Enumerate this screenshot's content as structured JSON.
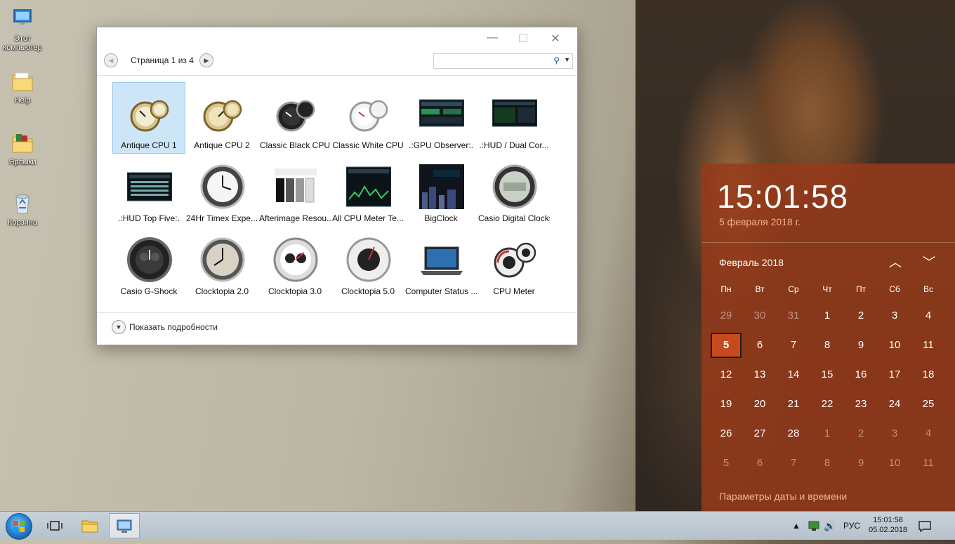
{
  "desktop": {
    "icons": [
      {
        "label": "Этот компьютер",
        "icon": "computer-icon"
      },
      {
        "label": "Help",
        "icon": "folder-icon"
      },
      {
        "label": "Ярлыки",
        "icon": "folder-icon"
      },
      {
        "label": "Корзина",
        "icon": "recycle-bin-icon"
      }
    ]
  },
  "gadget_window": {
    "page_label": "Страница 1 из 4",
    "search": {
      "value": "",
      "placeholder": ""
    },
    "gadgets": [
      {
        "name": "Antique CPU 1",
        "selected": true
      },
      {
        "name": "Antique CPU 2"
      },
      {
        "name": "Classic Black CPU"
      },
      {
        "name": "Classic White CPU"
      },
      {
        "name": ".:GPU Observer:."
      },
      {
        "name": ".:HUD / Dual Cor..."
      },
      {
        "name": ".:HUD Top Five:."
      },
      {
        "name": "24Hr Timex Expe..."
      },
      {
        "name": "Afterimage Resou..."
      },
      {
        "name": "All CPU Meter Te..."
      },
      {
        "name": "BigClock"
      },
      {
        "name": "Casio Digital Clocks"
      },
      {
        "name": "Casio G-Shock"
      },
      {
        "name": "Clocktopia 2.0"
      },
      {
        "name": "Clocktopia 3.0"
      },
      {
        "name": "Clocktopia 5.0"
      },
      {
        "name": "Computer Status ..."
      },
      {
        "name": "CPU Meter"
      }
    ],
    "details_label": "Показать подробности"
  },
  "calendar": {
    "time": "15:01:58",
    "date_long": "5 февраля 2018 г.",
    "month": "Февраль 2018",
    "weekdays": [
      "Пн",
      "Вт",
      "Ср",
      "Чт",
      "Пт",
      "Сб",
      "Вс"
    ],
    "weeks": [
      [
        "29",
        "30",
        "31",
        "1",
        "2",
        "3",
        "4"
      ],
      [
        "5",
        "6",
        "7",
        "8",
        "9",
        "10",
        "11"
      ],
      [
        "12",
        "13",
        "14",
        "15",
        "16",
        "17",
        "18"
      ],
      [
        "19",
        "20",
        "21",
        "22",
        "23",
        "24",
        "25"
      ],
      [
        "26",
        "27",
        "28",
        "1",
        "2",
        "3",
        "4"
      ],
      [
        "5",
        "6",
        "7",
        "8",
        "9",
        "10",
        "11"
      ]
    ],
    "dim_cells": [
      [
        0,
        0
      ],
      [
        0,
        1
      ],
      [
        0,
        2
      ],
      [
        4,
        3
      ],
      [
        4,
        4
      ],
      [
        4,
        5
      ],
      [
        4,
        6
      ],
      [
        5,
        0
      ],
      [
        5,
        1
      ],
      [
        5,
        2
      ],
      [
        5,
        3
      ],
      [
        5,
        4
      ],
      [
        5,
        5
      ],
      [
        5,
        6
      ]
    ],
    "today_cell": [
      1,
      0
    ],
    "settings_link": "Параметры даты и времени",
    "accent_color": "#c54a1c"
  },
  "taskbar": {
    "language": "РУС",
    "clock_time": "15:01:58",
    "clock_date": "05.02.2018"
  }
}
